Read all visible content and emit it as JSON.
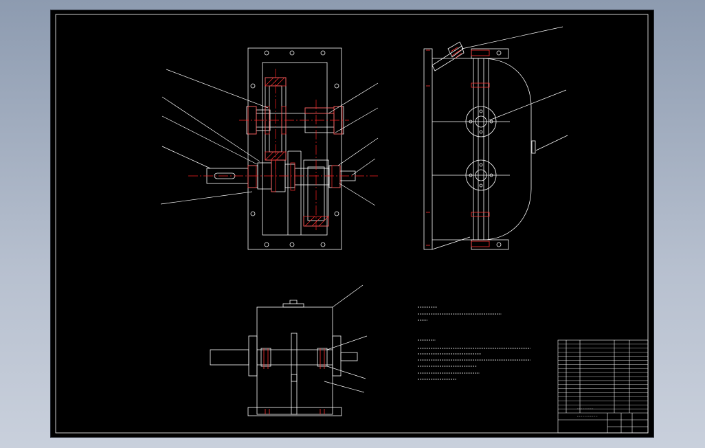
{
  "viewer": {
    "background_colors": [
      "#8d9bb0",
      "#c9d0dc"
    ],
    "sheet_color": "#000000"
  },
  "drawing": {
    "line_color": "#ffffff",
    "centerline_color": "#ff2020",
    "section_color": "#ff3030",
    "views": [
      "front-section-view",
      "side-view",
      "top-view"
    ],
    "notes": {
      "technical_characteristics_title": "",
      "technical_characteristics_lines": [],
      "technical_requirements_title": "",
      "technical_requirements_lines": []
    },
    "title_block": {
      "drawing_title": "",
      "parts_list_rows": 18
    }
  }
}
